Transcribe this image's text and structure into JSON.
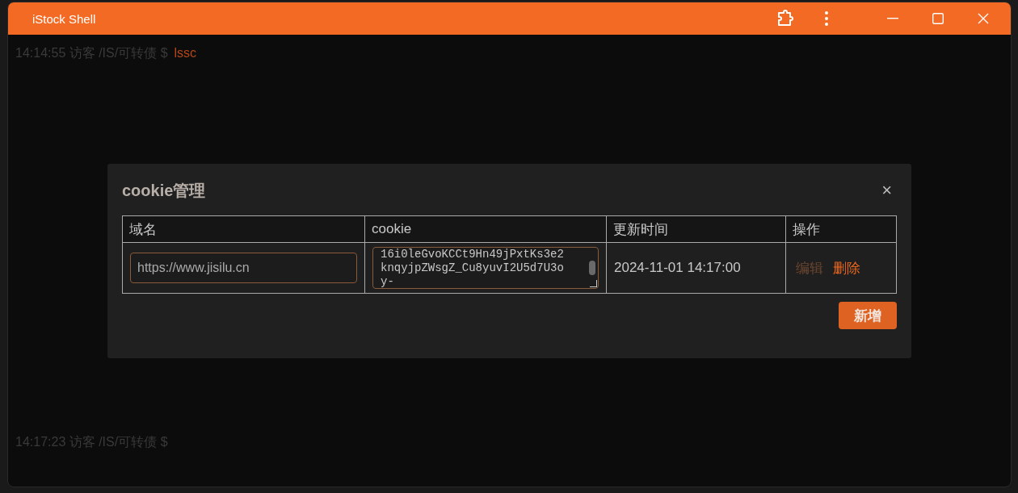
{
  "window": {
    "title": "iStock Shell"
  },
  "terminal": {
    "lines": [
      {
        "time": "14:14:55",
        "user": "访客",
        "path": "/IS/可转债",
        "prompt": "$",
        "command": "lssc"
      },
      {
        "time": "14:17:23",
        "user": "访客",
        "path": "/IS/可转债",
        "prompt": "$"
      }
    ]
  },
  "dialog": {
    "title": "cookie管理",
    "close": "×",
    "table": {
      "columns": [
        "域名",
        "cookie",
        "更新时间",
        "操作"
      ],
      "rows": [
        {
          "domain": "https://www.jisilu.cn",
          "cookie": "16i0leGvoKCCt9Hn49jPxtKs3e2knqyjpZWsgZ_Cu8yuvI2U5d7U3oy-",
          "updated": "2024-11-01 14:17:00",
          "actions": [
            {
              "label": "编辑",
              "disabled": true
            },
            {
              "label": "删除",
              "disabled": false
            }
          ]
        }
      ]
    },
    "add_button": "新增"
  }
}
